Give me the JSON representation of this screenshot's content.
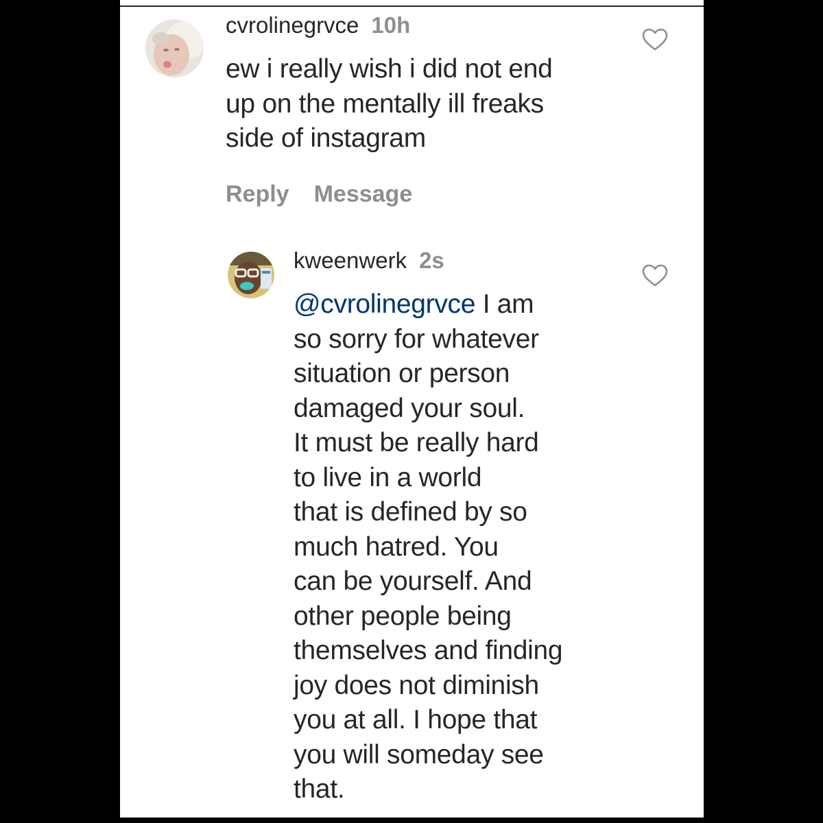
{
  "comments": [
    {
      "username": "cvrolinegrvce",
      "timestamp": "10h",
      "text": "ew i really wish i did not end\nup on  the mentally ill freaks\nside of instagram",
      "actions": {
        "reply": "Reply",
        "message": "Message"
      },
      "like_icon": "heart-outline-icon"
    },
    {
      "username": "kweenwerk",
      "timestamp": "2s",
      "mention": "@cvrolinegrvce",
      "text": " I am\nso sorry for whatever\nsituation or person\ndamaged your soul.\nIt must be really hard\nto live in a world\nthat is defined by so\nmuch hatred. You\ncan be yourself. And\nother people being\nthemselves and finding\njoy does not diminish\nyou at all. I hope that\nyou will someday see\nthat.",
      "like_icon": "heart-outline-icon"
    }
  ],
  "colors": {
    "primary_text": "#262626",
    "secondary_text": "#8e8e8e",
    "mention": "#00376b",
    "background": "#ffffff",
    "frame": "#000000"
  }
}
